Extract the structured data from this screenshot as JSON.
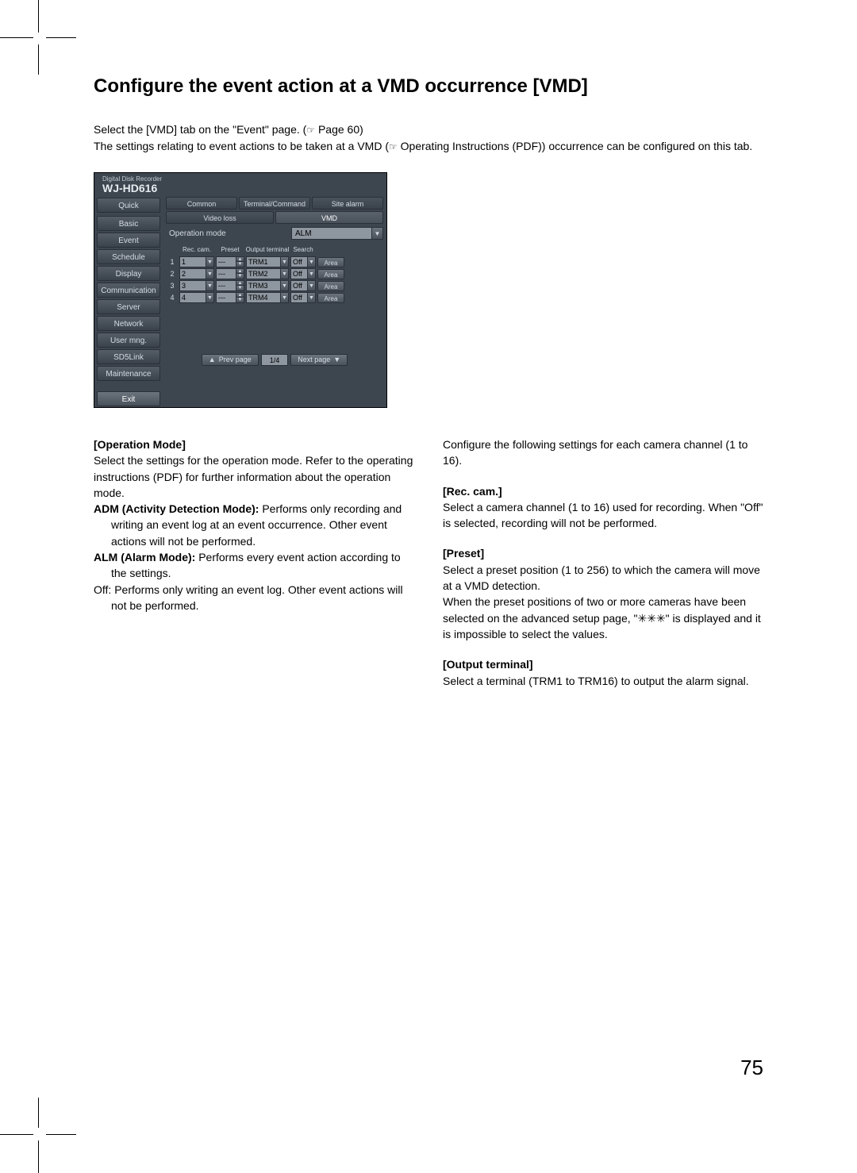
{
  "title": "Configure the event action at a VMD occurrence [VMD]",
  "intro": {
    "line1a": "Select the [VMD] tab on the \"Event\" page. (",
    "ref1": "☞",
    "line1b": " Page 60)",
    "line2a": "The settings relating to event actions to be taken at a VMD (",
    "ref2": "☞",
    "line2b": " Operating Instructions (PDF)) occurrence can be configured on this tab."
  },
  "screenshot": {
    "sub": "Digital Disk Recorder",
    "model": "WJ-HD616",
    "sidebar": [
      "Quick",
      "Basic",
      "Event",
      "Schedule",
      "Display",
      "Communication",
      "Server",
      "Network",
      "User mng.",
      "SD5Link",
      "Maintenance"
    ],
    "exit": "Exit",
    "tabs_top": [
      "Common",
      "Terminal/Command",
      "Site alarm"
    ],
    "tabs_bot": [
      "Video loss",
      "VMD"
    ],
    "op_label": "Operation mode",
    "op_value": "ALM",
    "headers": [
      "",
      "Rec. cam.",
      "Preset",
      "Output terminal",
      "Search",
      ""
    ],
    "rows": [
      {
        "idx": "1",
        "rec": "1",
        "preset": "---",
        "out": "TRM1",
        "search": "Off",
        "area": "Area"
      },
      {
        "idx": "2",
        "rec": "2",
        "preset": "---",
        "out": "TRM2",
        "search": "Off",
        "area": "Area"
      },
      {
        "idx": "3",
        "rec": "3",
        "preset": "---",
        "out": "TRM3",
        "search": "Off",
        "area": "Area"
      },
      {
        "idx": "4",
        "rec": "4",
        "preset": "---",
        "out": "TRM4",
        "search": "Off",
        "area": "Area"
      }
    ],
    "prev": "Prev page",
    "page": "1/4",
    "next": "Next page"
  },
  "left": {
    "h1": "[Operation Mode]",
    "p1": "Select the settings for the operation mode. Refer to the operating instructions (PDF) for further information about the operation mode.",
    "adm_lead": "ADM (Activity Detection Mode):",
    "adm_body": " Performs only recording and writing an event log at an event occurrence. Other event actions will not be performed.",
    "alm_lead": "ALM (Alarm Mode):",
    "alm_body": " Performs every event action according to the settings.",
    "off_lead": "Off:",
    "off_body": "Performs only writing an event log. Other event actions will not be performed."
  },
  "right": {
    "p0": "Configure the following settings for each camera channel (1 to 16).",
    "h1": "[Rec. cam.]",
    "p1": "Select a camera channel (1 to 16) used for recording. When \"Off\" is selected, recording will not be performed.",
    "h2": "[Preset]",
    "p2": "Select a preset position (1 to 256) to which the camera will move at a VMD detection.",
    "p2b": "When the preset positions of two or more cameras have been selected on the advanced setup page, \"✳✳✳\" is displayed and it is impossible to select the values.",
    "h3": "[Output terminal]",
    "p3": "Select a terminal (TRM1 to TRM16) to output the alarm signal."
  },
  "pagenum": "75"
}
